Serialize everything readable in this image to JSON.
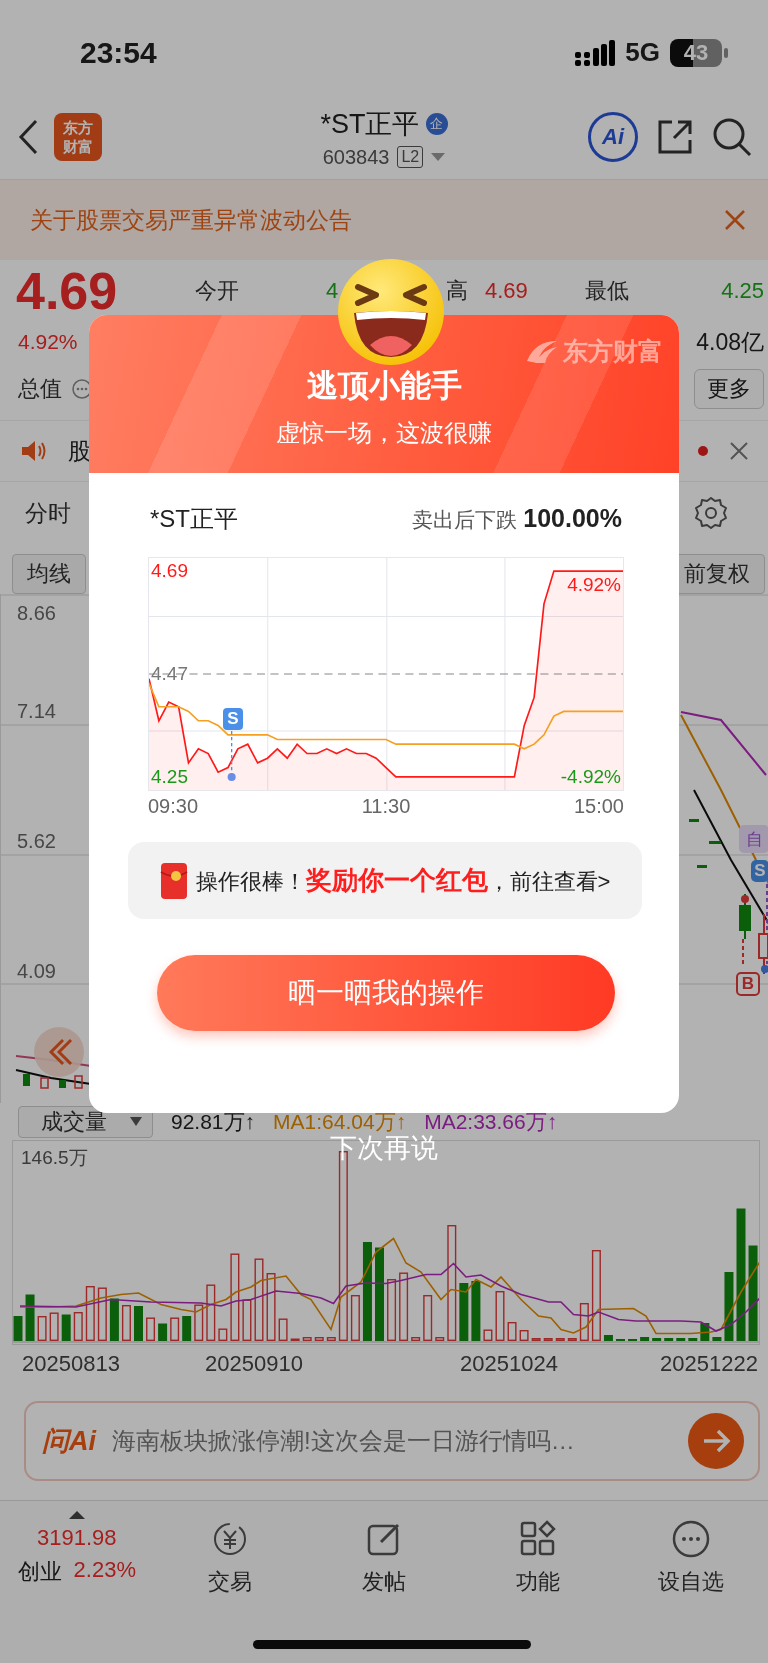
{
  "status_bar": {
    "time": "23:54",
    "network": "5G",
    "battery": "43"
  },
  "header": {
    "logo": "东方财富",
    "title": "*ST正平",
    "badge": "企",
    "code": "603843",
    "level_tag": "L2",
    "ai_button": "Ai"
  },
  "notice": {
    "text": "关于股票交易严重异常波动公告"
  },
  "quote": {
    "price": "4.69",
    "change": "4.92%",
    "stats": [
      {
        "label": "今开",
        "value": "4"
      },
      {
        "label": "高",
        "value": "4.69"
      },
      {
        "label": "最低",
        "value": "4.25"
      }
    ],
    "turnover": "4.08亿",
    "market_value_label": "总值",
    "more_button": "更多"
  },
  "news_ticker": {
    "text": "股"
  },
  "chart_tabs": {
    "tab": "分时"
  },
  "kline": {
    "ma_button": "均线",
    "adjust_button": "前复权",
    "y_labels": [
      "8.66",
      "7.14",
      "5.62",
      "4.09"
    ],
    "markers": [
      "自",
      "S",
      "B"
    ]
  },
  "volume": {
    "selector": "成交量",
    "indicators": [
      {
        "text": "92.81万↑"
      },
      {
        "text": "MA1:64.04万↑"
      },
      {
        "text": "MA2:33.66万↑"
      }
    ],
    "max_label": "146.5万",
    "dates": [
      "20250813",
      "20250910",
      "20251024",
      "20251222"
    ]
  },
  "ask_ai": {
    "logo": "问Ai",
    "text": "海南板块掀涨停潮!这次会是一日游行情吗…"
  },
  "bottom_nav": {
    "index": {
      "value": "3191.98",
      "name": "创业",
      "change": "2.23%"
    },
    "items": [
      {
        "label": "交易"
      },
      {
        "label": "发帖"
      },
      {
        "label": "功能"
      },
      {
        "label": "设自选"
      }
    ]
  },
  "popup": {
    "title": "逃顶小能手",
    "subtitle": "虚惊一场，这波很赚",
    "watermark": "东方财富",
    "stock_name": "*ST正平",
    "result": "卖出后下跌 **100.00%**",
    "chart": {
      "high_pct": "4.92%",
      "low_pct": "-4.92%",
      "sell_marker": "S",
      "times": [
        "09:30",
        "11:30",
        "15:00"
      ],
      "chart_data": {
        "type": "line",
        "grid": true,
        "series": [
          {
            "type": "area",
            "color": "#ff1a1a",
            "values": [
              4.46,
              4.37,
              4.41,
              4.4,
              4.28,
              4.31,
              4.3,
              4.26,
              4.27,
              4.31,
              4.32,
              4.28,
              4.29,
              4.31,
              4.29,
              4.32,
              4.3,
              4.3,
              4.31,
              4.3,
              4.31,
              4.3,
              4.3,
              4.29,
              4.27,
              4.25,
              4.25,
              4.25,
              4.25,
              4.25,
              4.25,
              4.25,
              4.25,
              4.25,
              4.25,
              4.25,
              4.25,
              4.25,
              4.36,
              4.42,
              4.62,
              4.69,
              4.69,
              4.69,
              4.69,
              4.69,
              4.69,
              4.69,
              4.69
            ]
          },
          {
            "color": "#f5a020",
            "values": [
              4.45,
              4.4,
              4.4,
              4.4,
              4.39,
              4.37,
              4.37,
              4.36,
              4.34,
              4.34,
              4.34,
              4.34,
              4.34,
              4.33,
              4.33,
              4.33,
              4.33,
              4.33,
              4.33,
              4.33,
              4.33,
              4.33,
              4.33,
              4.33,
              4.33,
              4.32,
              4.32,
              4.32,
              4.32,
              4.32,
              4.32,
              4.32,
              4.32,
              4.32,
              4.32,
              4.32,
              4.32,
              4.32,
              4.31,
              4.32,
              4.34,
              4.38,
              4.39,
              4.39,
              4.39,
              4.39,
              4.39,
              4.39,
              4.39
            ]
          },
          {
            "color": "#888888",
            "line_style": "dashed",
            "values": [
              4.47,
              4.47,
              4.47,
              4.47,
              4.47,
              4.47,
              4.47,
              4.47,
              4.47,
              4.47,
              4.47,
              4.47,
              4.47,
              4.47,
              4.47,
              4.47,
              4.47,
              4.47,
              4.47,
              4.47,
              4.47,
              4.47,
              4.47,
              4.47,
              4.47,
              4.47,
              4.47,
              4.47,
              4.47,
              4.47,
              4.47,
              4.47,
              4.47,
              4.47,
              4.47,
              4.47,
              4.47,
              4.47,
              4.47,
              4.47,
              4.47,
              4.47,
              4.47,
              4.47,
              4.47,
              4.47,
              4.47,
              4.47,
              4.47
            ]
          }
        ],
        "ylim": [
          4.222,
          4.718
        ],
        "yticks": [
          {
            "value": 4.25,
            "label": "4.25"
          },
          {
            "value": 4.47,
            "label": "4.47"
          },
          {
            "value": 4.69,
            "label": "4.69"
          }
        ]
      }
    },
    "reward": "操作很棒！**奖励你一个红包**，前往查看>",
    "share_button": "晒一晒我的操作",
    "dismiss": "下次再说"
  }
}
